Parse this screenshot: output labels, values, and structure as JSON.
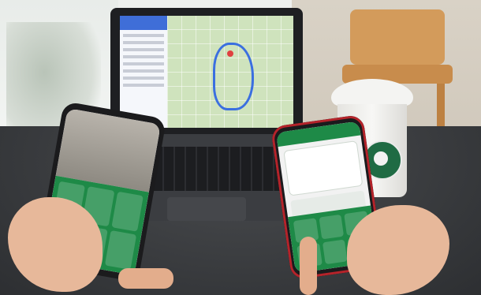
{
  "scene": {
    "colors": {
      "table": "#3a3c3f",
      "laptop_map": "#cfe3bd",
      "route": "#3b6fe0",
      "app_green": "#1e8a47",
      "phone_red": "#b5232a",
      "cup_logo_green": "#1f6b44",
      "chair_wood": "#d39b5b"
    }
  }
}
